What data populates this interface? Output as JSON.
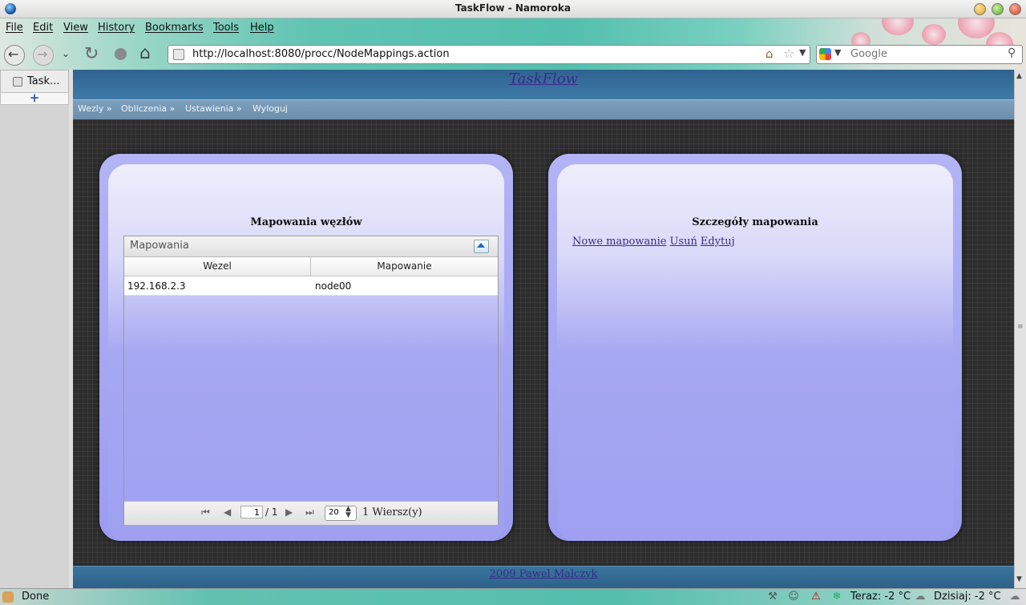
{
  "window": {
    "title": "TaskFlow - Namoroka"
  },
  "menu": [
    "File",
    "Edit",
    "View",
    "History",
    "Bookmarks",
    "Tools",
    "Help"
  ],
  "url": "http://localhost:8080/procc/NodeMappings.action",
  "search": {
    "placeholder": "Google"
  },
  "tabs": [
    {
      "label": "Task..."
    }
  ],
  "site": {
    "title": "TaskFlow",
    "nav": [
      "Wezly »",
      "Obliczenia »",
      "Ustawienia »",
      "Wyloguj"
    ],
    "footer": "2009 Pawel Malczyk"
  },
  "left_panel": {
    "title": "Mapowania węzłów",
    "grid": {
      "caption": "Mapowania",
      "columns": [
        "Wezel",
        "Mapowanie"
      ],
      "rows": [
        [
          "192.168.2.3",
          "node00"
        ]
      ],
      "pager": {
        "page": "1",
        "of": "/ 1",
        "page_size": "20",
        "info": "1 Wiersz(y)"
      }
    }
  },
  "right_panel": {
    "title": "Szczegóły mapowania",
    "links": [
      "Nowe mapowanie",
      "Usuń",
      "Edytuj"
    ]
  },
  "status": {
    "text": "Done",
    "weather_now": "Teraz: -2 °C",
    "weather_today": "Dzisiaj: -2 °C"
  }
}
